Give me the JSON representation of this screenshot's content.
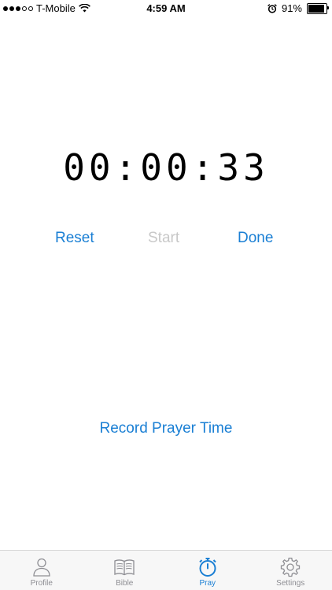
{
  "status_bar": {
    "carrier": "T-Mobile",
    "time": "4:59 AM",
    "battery": "91%",
    "battery_level": 0.91,
    "signal_bars_filled": 3,
    "signal_bars_total": 5
  },
  "timer": {
    "display": "00:00:33"
  },
  "controls": {
    "reset_label": "Reset",
    "start_label": "Start",
    "done_label": "Done"
  },
  "record": {
    "label": "Record Prayer Time"
  },
  "tab_bar": {
    "active": "Pray",
    "items": [
      {
        "label": "Profile",
        "icon": "person-icon"
      },
      {
        "label": "Bible",
        "icon": "book-icon"
      },
      {
        "label": "Pray",
        "icon": "stopwatch-icon"
      },
      {
        "label": "Settings",
        "icon": "gear-icon"
      }
    ]
  },
  "colors": {
    "accent": "#1a7fd4",
    "disabled": "#c8c8c8",
    "tab_inactive": "#8e8e93"
  }
}
